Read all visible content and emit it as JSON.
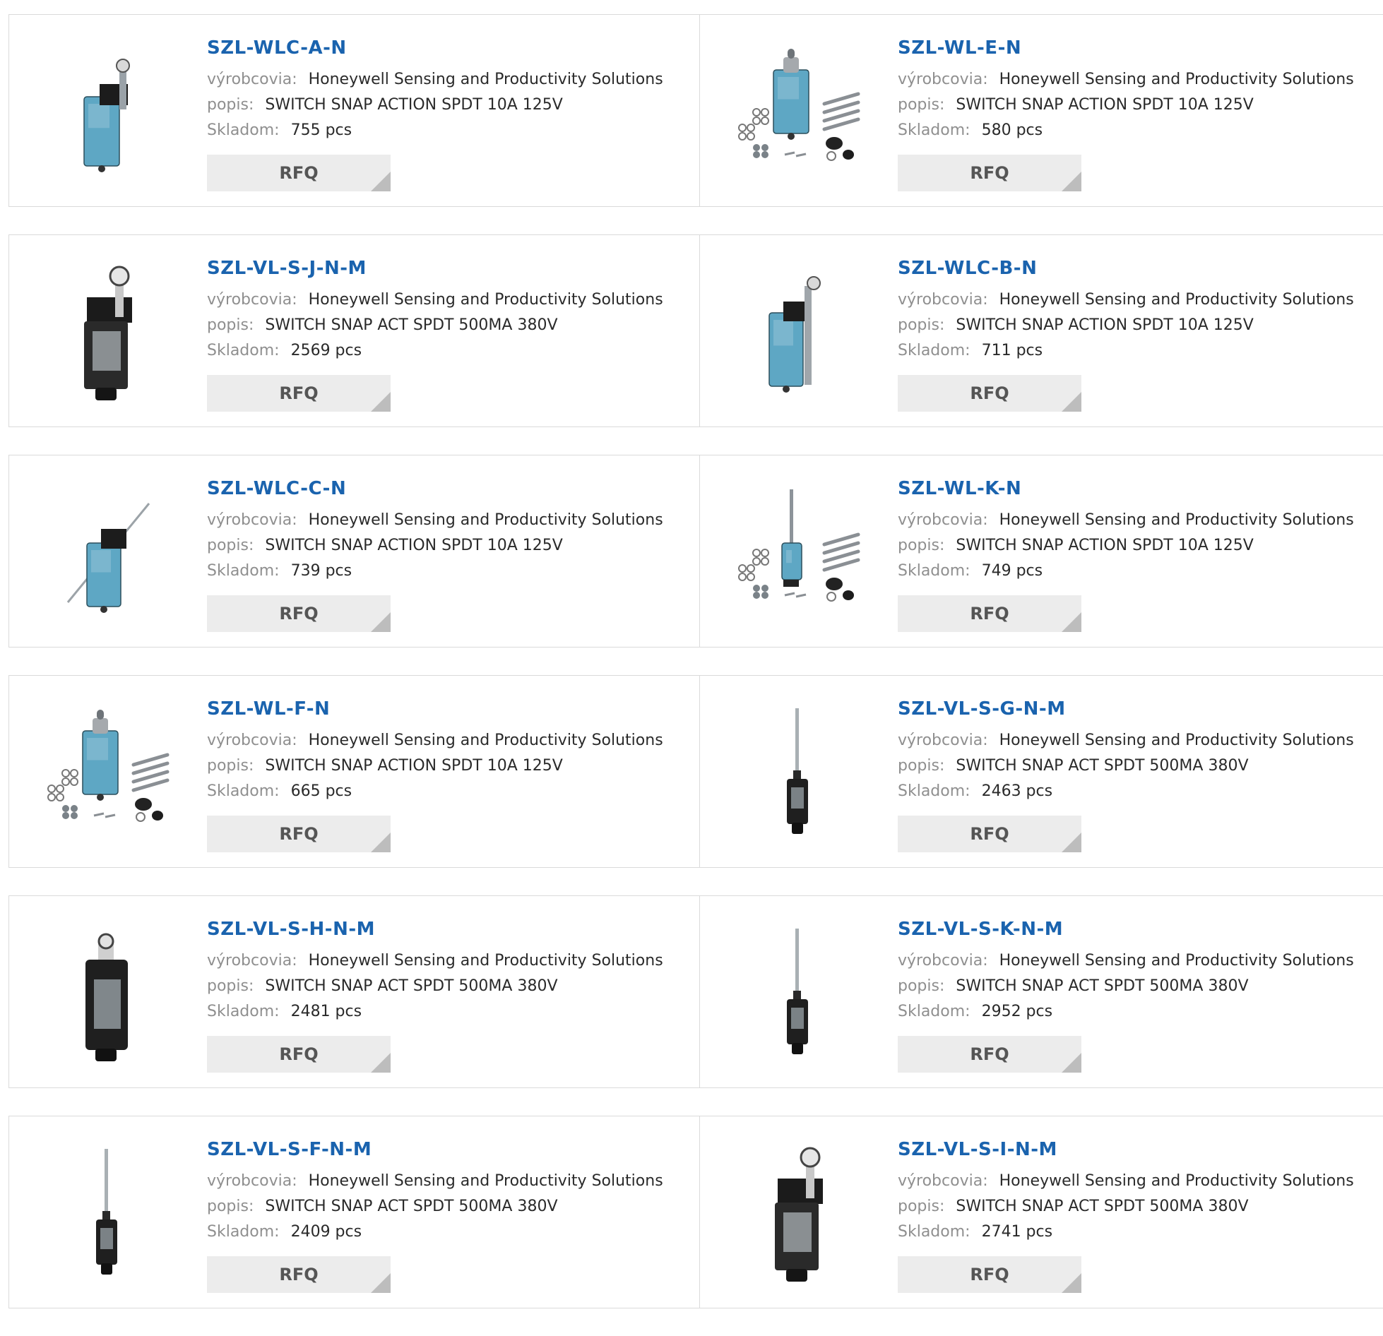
{
  "labels": {
    "manufacturer": "výrobcovia:",
    "description": "popis:",
    "stock": "Skladom:",
    "rfq": "RFQ"
  },
  "products": [
    {
      "pn": "SZL-WLC-A-N",
      "manufacturer": "Honeywell Sensing and Productivity Solutions",
      "description": "SWITCH SNAP ACTION SPDT 10A 125V",
      "stock": "755 pcs",
      "image": "roller-lever-switch-blue"
    },
    {
      "pn": "SZL-WL-E-N",
      "manufacturer": "Honeywell Sensing and Productivity Solutions",
      "description": "SWITCH SNAP ACTION SPDT 10A 125V",
      "stock": "580 pcs",
      "image": "plunger-switch-kit-blue"
    },
    {
      "pn": "SZL-VL-S-J-N-M",
      "manufacturer": "Honeywell Sensing and Productivity Solutions",
      "description": "SWITCH SNAP ACT SPDT 500MA 380V",
      "stock": "2569 pcs",
      "image": "roller-lever-switch-black"
    },
    {
      "pn": "SZL-WLC-B-N",
      "manufacturer": "Honeywell Sensing and Productivity Solutions",
      "description": "SWITCH SNAP ACTION SPDT 10A 125V",
      "stock": "711 pcs",
      "image": "adjustable-roller-lever-switch-blue"
    },
    {
      "pn": "SZL-WLC-C-N",
      "manufacturer": "Honeywell Sensing and Productivity Solutions",
      "description": "SWITCH SNAP ACTION SPDT 10A 125V",
      "stock": "739 pcs",
      "image": "rod-lever-switch-blue"
    },
    {
      "pn": "SZL-WL-K-N",
      "manufacturer": "Honeywell Sensing and Productivity Solutions",
      "description": "SWITCH SNAP ACTION SPDT 10A 125V",
      "stock": "749 pcs",
      "image": "wobble-stick-switch-kit-blue"
    },
    {
      "pn": "SZL-WL-F-N",
      "manufacturer": "Honeywell Sensing and Productivity Solutions",
      "description": "SWITCH SNAP ACTION SPDT 10A 125V",
      "stock": "665 pcs",
      "image": "plunger-switch-kit-blue"
    },
    {
      "pn": "SZL-VL-S-G-N-M",
      "manufacturer": "Honeywell Sensing and Productivity Solutions",
      "description": "SWITCH SNAP ACT SPDT 500MA 380V",
      "stock": "2463 pcs",
      "image": "wobble-stick-switch-black"
    },
    {
      "pn": "SZL-VL-S-H-N-M",
      "manufacturer": "Honeywell Sensing and Productivity Solutions",
      "description": "SWITCH SNAP ACT SPDT 500MA 380V",
      "stock": "2481 pcs",
      "image": "roller-plunger-switch-black"
    },
    {
      "pn": "SZL-VL-S-K-N-M",
      "manufacturer": "Honeywell Sensing and Productivity Solutions",
      "description": "SWITCH SNAP ACT SPDT 500MA 380V",
      "stock": "2952 pcs",
      "image": "wobble-stick-switch-black"
    },
    {
      "pn": "SZL-VL-S-F-N-M",
      "manufacturer": "Honeywell Sensing and Productivity Solutions",
      "description": "SWITCH SNAP ACT SPDT 500MA 380V",
      "stock": "2409 pcs",
      "image": "wobble-stick-switch-black"
    },
    {
      "pn": "SZL-VL-S-I-N-M",
      "manufacturer": "Honeywell Sensing and Productivity Solutions",
      "description": "SWITCH SNAP ACT SPDT 500MA 380V",
      "stock": "2741 pcs",
      "image": "roller-lever-switch-black"
    }
  ]
}
